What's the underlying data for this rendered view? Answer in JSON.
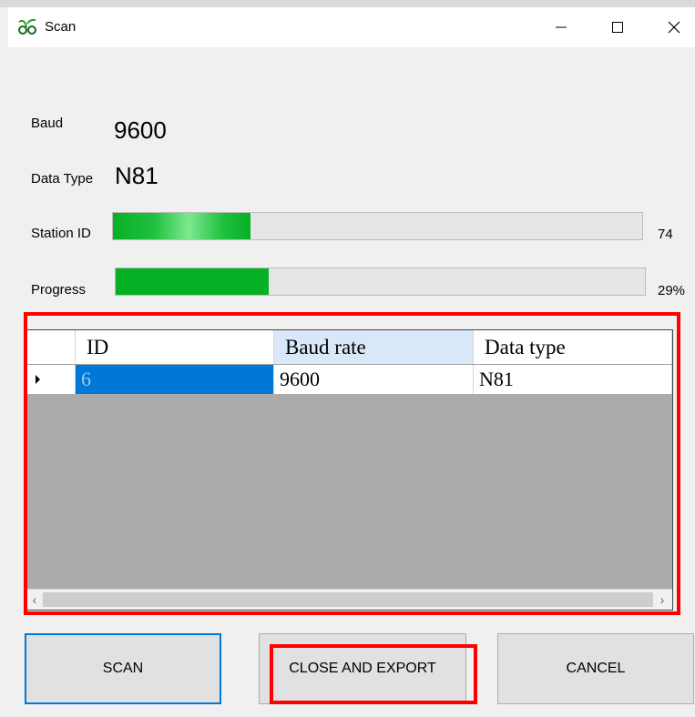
{
  "window": {
    "title": "Scan"
  },
  "fields": {
    "baud_label": "Baud",
    "baud_value": "9600",
    "data_type_label": "Data Type",
    "data_type_value": "N81"
  },
  "station_id": {
    "label": "Station ID",
    "value_text": "74",
    "fill_fraction": 0.26
  },
  "progress": {
    "label": "Progress",
    "percent_text": "29%",
    "fill_fraction": 0.29
  },
  "grid": {
    "columns": [
      "ID",
      "Baud rate",
      "Data type"
    ],
    "rows": [
      {
        "id": "6",
        "baud_rate": "9600",
        "data_type": "N81"
      }
    ]
  },
  "buttons": {
    "scan": "SCAN",
    "close_export": "CLOSE AND EXPORT",
    "cancel": "CANCEL"
  },
  "colors": {
    "progress_green": "#06b025",
    "selection_blue": "#0078d7",
    "highlight_red": "#ff0000"
  },
  "icons": {
    "app": "app-logo-icon",
    "minimize": "minimize-icon",
    "maximize": "maximize-icon",
    "close": "close-icon"
  }
}
